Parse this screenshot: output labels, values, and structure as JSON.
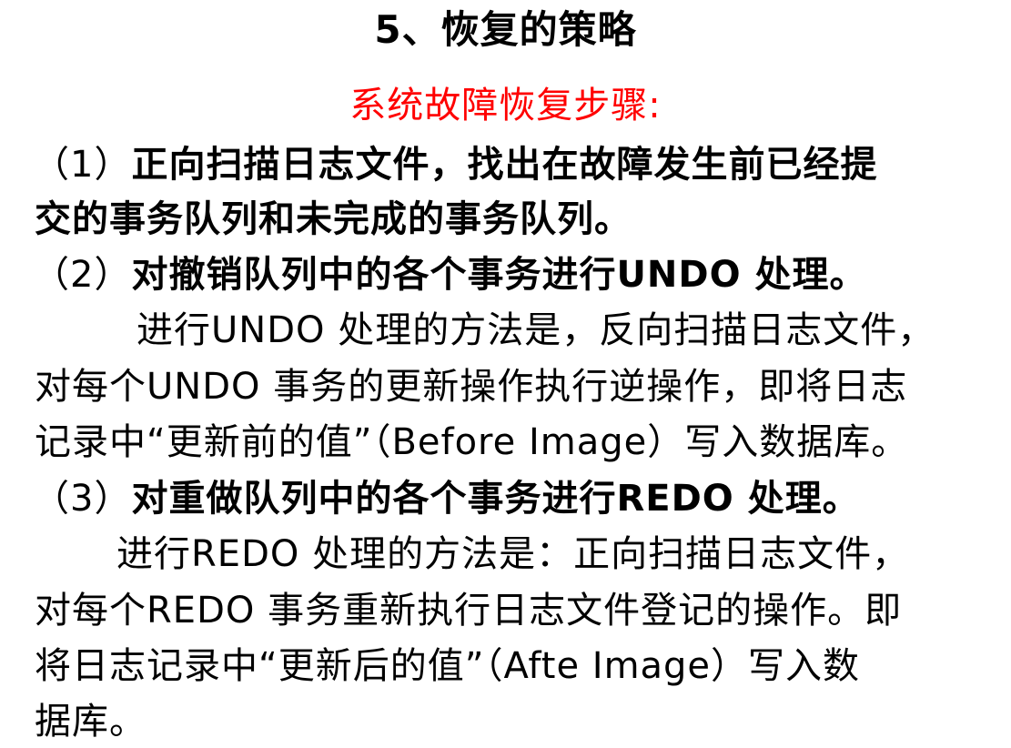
{
  "slide": {
    "title": "5、恢复的策略",
    "subtitle": "系统故障恢复步骤:",
    "subtitle_color": "#ff0000",
    "steps": [
      {
        "number": "（1）",
        "heading_line1": "正向扫描日志文件，找出在故障发生前已经提",
        "heading_line2": "交的事务队列和未完成的事务队列。"
      },
      {
        "number": "（2）",
        "heading": "对撤销队列中的各个事务进行UNDO 处理。",
        "body": [
          "进行UNDO 处理的方法是，反向扫描日志文件，",
          "对每个UNDO 事务的更新操作执行逆操作，即将日志",
          "记录中“更新前的值”（Before Image）写入数据库。"
        ]
      },
      {
        "number": "（3）",
        "heading": "对重做队列中的各个事务进行REDO 处理。",
        "body": [
          "进行REDO 处理的方法是：正向扫描日志文件，",
          "对每个REDO 事务重新执行日志文件登记的操作。即",
          "将日志记录中“更新后的值”（Afte Image）写入数",
          "据库。"
        ]
      }
    ]
  }
}
